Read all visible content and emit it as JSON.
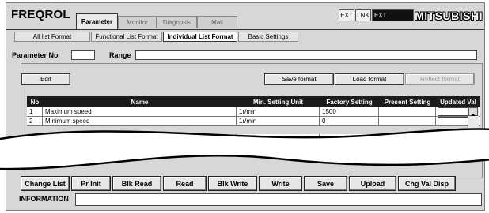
{
  "app": {
    "logo": "FREQROL",
    "brand": "MITSUBISHI"
  },
  "main_tabs": [
    "Parameter",
    "Monitor",
    "Diagnosis",
    "Mail"
  ],
  "indicators": [
    "EXT",
    "LNK",
    "EXT"
  ],
  "sub_tabs": [
    "All list Format",
    "Functional List Format",
    "Individual List Format",
    "Basic Settings"
  ],
  "params": {
    "param_no_label": "Parameter No",
    "param_no_value": "",
    "range_label": "Range",
    "range_value": ""
  },
  "buttons": {
    "edit": "Edit",
    "save_format": "Save format",
    "load_format": "Load format",
    "reflect_format": "Reflect format"
  },
  "table": {
    "headers": [
      "No",
      "Name",
      "Min. Setting Unit",
      "Factory Setting",
      "Present Setting",
      "Updated Val"
    ],
    "rows": [
      {
        "no": "1",
        "name": "Maximum speed",
        "unit": "1r/min",
        "factory": "1500"
      },
      {
        "no": "2",
        "name": "Minimum speed",
        "unit": "1r/min",
        "factory": "0"
      }
    ],
    "partial_row": {
      "factory": "1500"
    }
  },
  "bottom_buttons": [
    "Change List",
    "Pr Init",
    "Blk Read",
    "Read",
    "Blk Write",
    "Write",
    "Save",
    "Upload",
    "Chg Val Disp"
  ],
  "info": {
    "label": "INFORMATION",
    "value": ""
  }
}
